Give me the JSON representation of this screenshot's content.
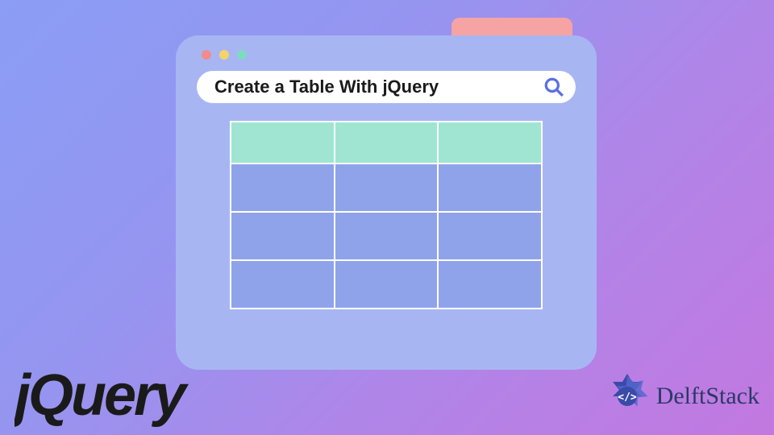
{
  "colors": {
    "window_bg": "#a7b6f2",
    "pink_tab": "#f5a3a3",
    "dot_red": "#f08c8c",
    "dot_yellow": "#f5d36b",
    "dot_green": "#7fd9c4",
    "table_header": "#9fe5d2",
    "table_cell": "#8fa3ea",
    "table_border": "#ffffff",
    "search_icon": "#5b6fe0",
    "jquery_logo": "#1a1a1a",
    "delft_text": "#2a3a66"
  },
  "searchbar": {
    "text": "Create a Table With jQuery"
  },
  "table": {
    "columns": 3,
    "rows": 4
  },
  "brand": {
    "jquery": "jQuery",
    "delft": "DelftStack"
  }
}
